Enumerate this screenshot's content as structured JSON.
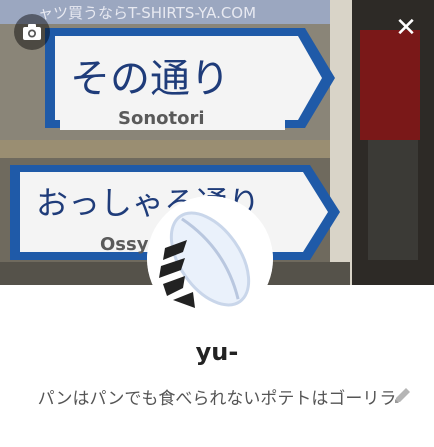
{
  "profile": {
    "name": "yu-",
    "bio": "パンはパンでも食べられないポテトはゴーリラ"
  },
  "cover": {
    "sign_top_jp": "その通り",
    "sign_top_en": "Sonotori",
    "sign_bottom_jp": "おっしゃる通り",
    "sign_bottom_en": "Ossya",
    "shop_sign": "ャツ買うならT-SHIRTS-YA.COM"
  },
  "icons": {
    "camera": "camera-icon",
    "close": "close-icon",
    "edit": "pencil-icon"
  },
  "colors": {
    "sign_blue": "#1f5aa8",
    "sign_white": "#f4f4f4",
    "text_dark": "#222222",
    "text_muted": "#555555"
  }
}
